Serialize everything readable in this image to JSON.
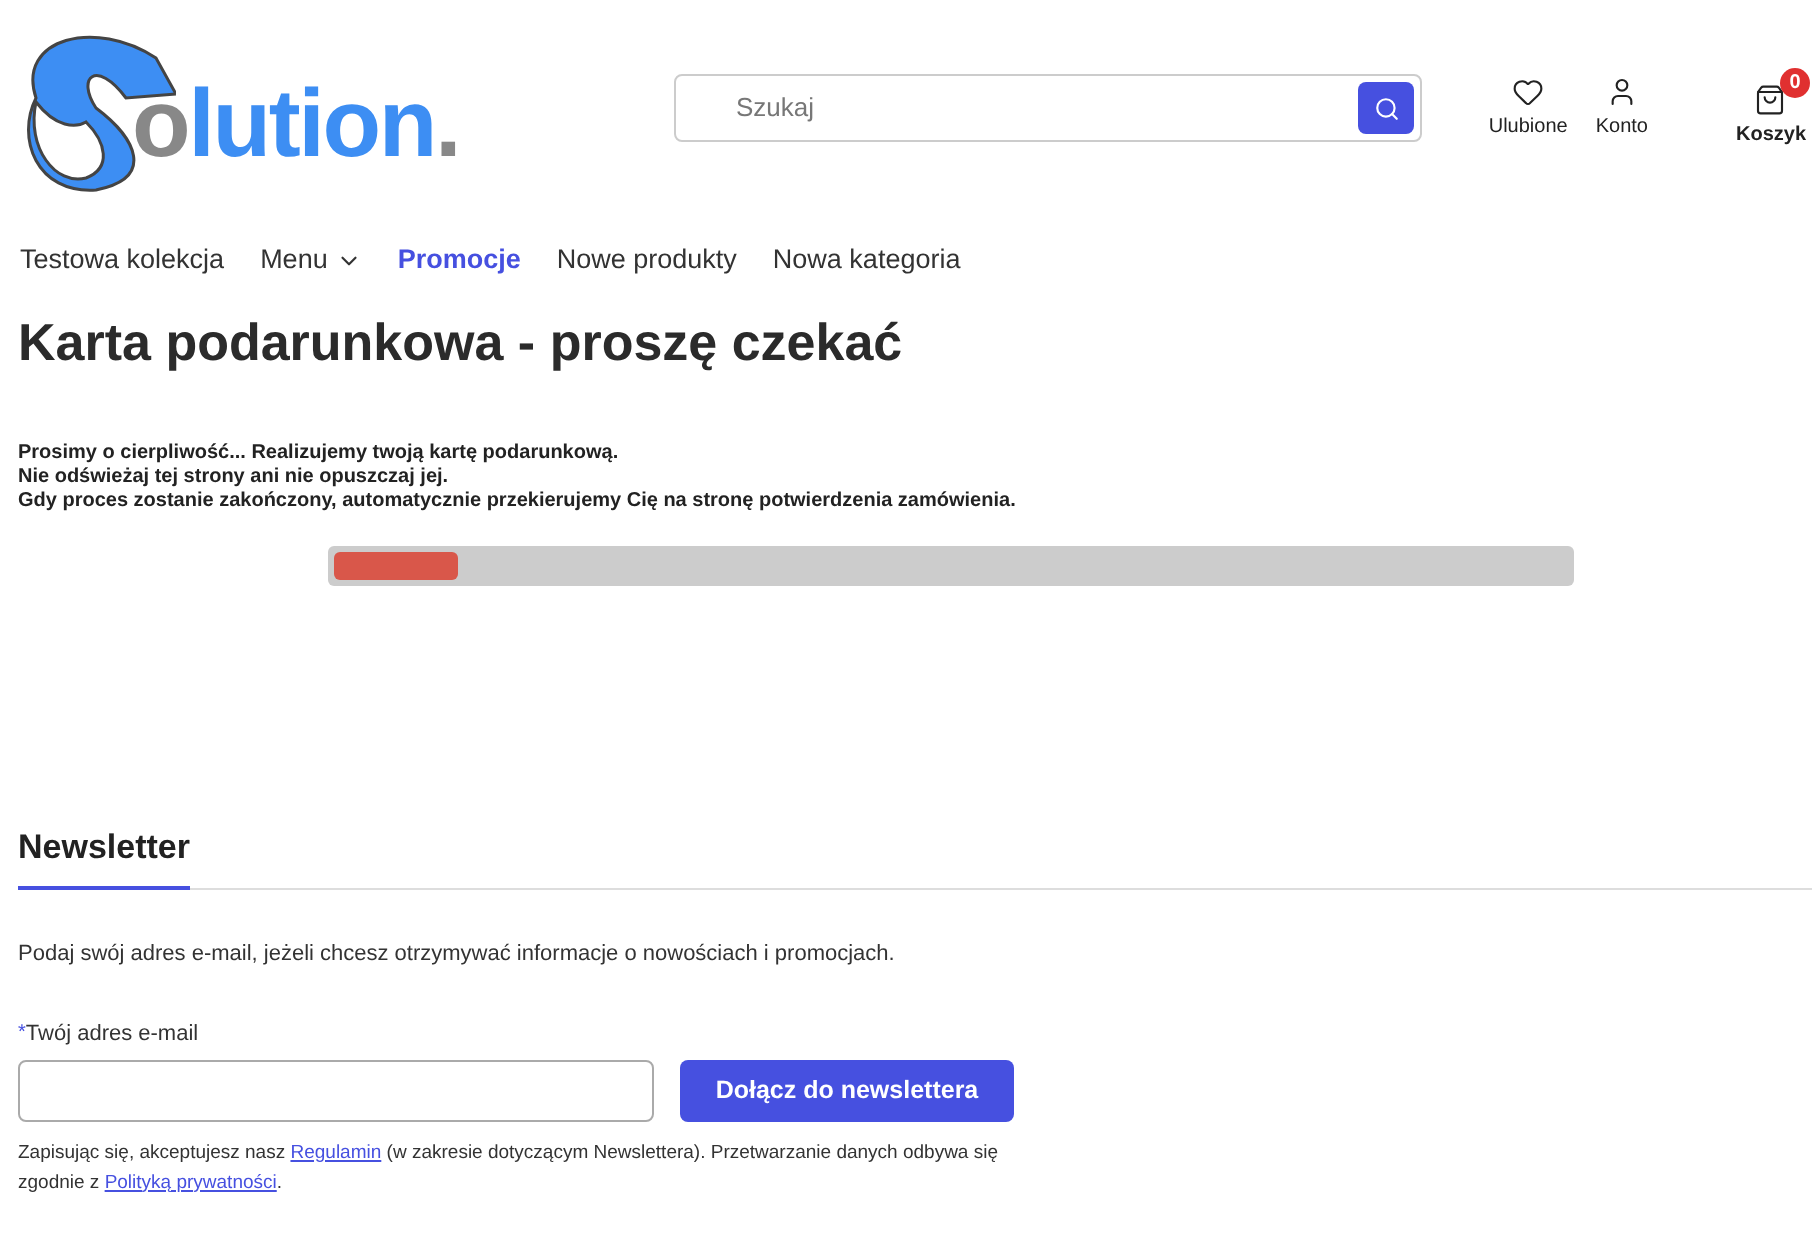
{
  "logo": {
    "initial": "o",
    "rest": "lution",
    "dot": "."
  },
  "search": {
    "placeholder": "Szukaj"
  },
  "header_links": [
    {
      "kind": "heart",
      "label": "Ulubione"
    },
    {
      "kind": "user",
      "label": "Konto"
    },
    {
      "kind": "cart",
      "label": "Koszyk",
      "badge": "0"
    }
  ],
  "nav": [
    {
      "label": "Testowa kolekcja",
      "selected": false,
      "dropdown": false
    },
    {
      "label": "Menu",
      "selected": false,
      "dropdown": true
    },
    {
      "label": "Promocje",
      "selected": true,
      "dropdown": false
    },
    {
      "label": "Nowe produkty",
      "selected": false,
      "dropdown": false
    },
    {
      "label": "Nowa kategoria",
      "selected": false,
      "dropdown": false
    }
  ],
  "title": "Karta podarunkowa - proszę czekać",
  "messages": [
    "Prosimy o cierpliwość... Realizujemy twoją kartę podarunkową.",
    "Nie odświeżaj tej strony ani nie opuszczaj jej.",
    "Gdy proces zostanie zakończony, automatycznie przekierujemy Cię na stronę potwierdzenia zamówienia."
  ],
  "progress": {
    "level": 0.1
  },
  "newsletter": {
    "heading": "Newsletter",
    "intro": "Podaj swój adres e-mail, jeżeli chcesz otrzymywać informacje o nowościach i promocjach.",
    "required_mark": "*",
    "email_label": "Twój adres e-mail",
    "button": "Dołącz do newslettera",
    "consent": {
      "before": "Zapisując się, akceptujesz nasz ",
      "link_1": "Regulamin",
      "middle": " (w zakresie dotyczącym Newslettera). Przetwarzanie danych odbywa się zgodnie z ",
      "link_2": "Polityką prywatności",
      "after": "."
    }
  }
}
